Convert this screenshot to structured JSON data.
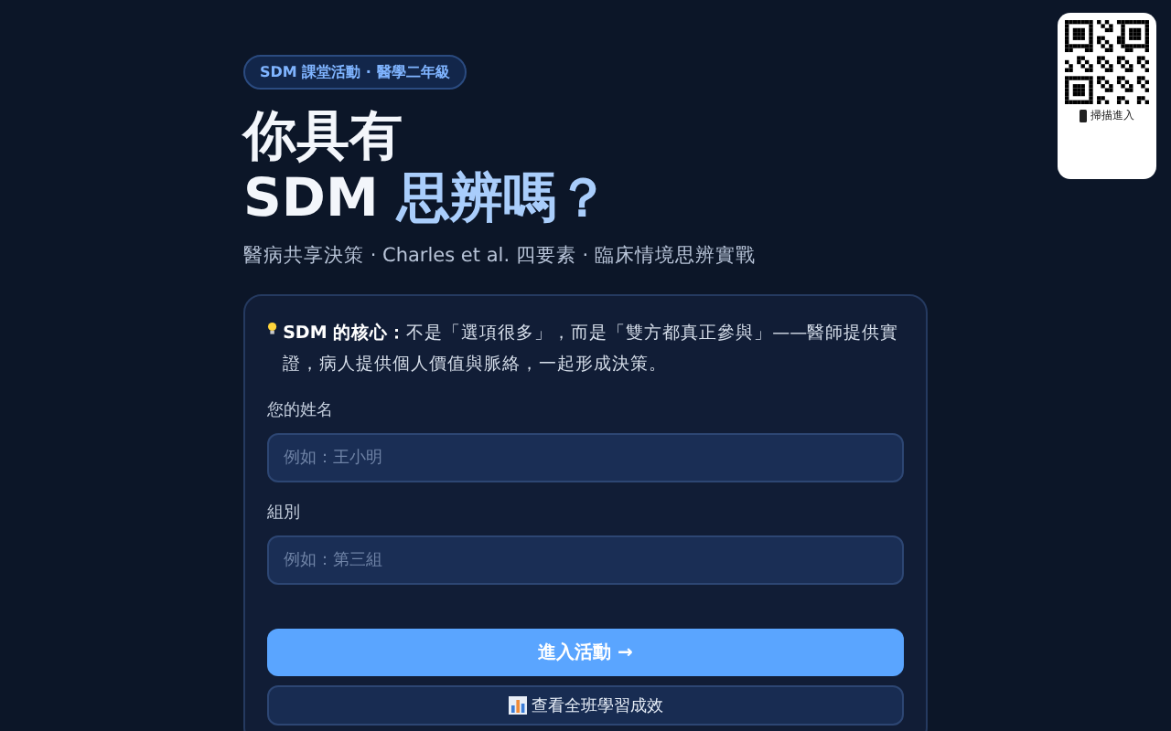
{
  "badge": "SDM 課堂活動 · 醫學二年級",
  "title": {
    "line_1": "你具有",
    "line_2_plain": "SDM",
    "line_2_highlight": "思辨嗎？"
  },
  "subtitle": "醫病共享決策 · Charles et al. 四要素 · 臨床情境思辨實戰",
  "card": {
    "intro": "**SDM 的核心：**不是「選項很多」，而是「雙方都真正參與」——醫師提供實證，病人提供個人價值與脈絡，一起形成決策。",
    "fields": [
      {
        "label": "您的姓名",
        "placeholder": "例如：王小明"
      },
      {
        "label": "組別",
        "placeholder": "例如：第三組"
      }
    ],
    "primary_button": "進入活動 →",
    "secondary_button": "查看全班學習成效"
  },
  "qr": {
    "caption": "掃描進入"
  }
}
